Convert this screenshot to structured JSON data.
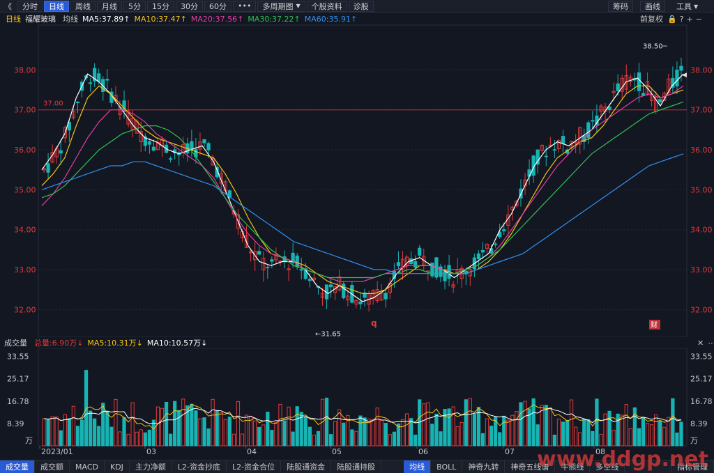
{
  "toolbar": {
    "back": "《",
    "tabs": [
      "分时",
      "日线",
      "周线",
      "月线",
      "5分",
      "15分",
      "30分",
      "60分"
    ],
    "active_tab": 1,
    "more": "•••",
    "multi_period": "多周期图",
    "stock_info": "个股资料",
    "diagnose": "诊股",
    "chips": "筹码",
    "draw": "画线",
    "tools": "工具"
  },
  "ma_bar": {
    "period": "日线",
    "name": "福耀玻璃",
    "avg": "均线",
    "ma5": "MA5:37.89↑",
    "ma10": "MA10:37.47↑",
    "ma20": "MA20:37.56↑",
    "ma30": "MA30:37.22↑",
    "ma60": "MA60:35.91↑",
    "adjust": "前复权"
  },
  "colors": {
    "ma5": "#ffffff",
    "ma10": "#f5c518",
    "ma20": "#e040a0",
    "ma30": "#30c050",
    "ma60": "#3090f0",
    "up": "#e23a3a",
    "down": "#18b4b4",
    "price_axis": "#e23a3a"
  },
  "price_axis": [
    "38.00",
    "37.00",
    "36.00",
    "35.00",
    "34.00",
    "33.00",
    "32.00"
  ],
  "annotations": {
    "ref_line": "37.00",
    "high": "38.50",
    "low": "←31.65",
    "q_marker": "q",
    "cai_marker": "财"
  },
  "volume_bar": {
    "label": "成交量",
    "total": "总量:6.90万↓",
    "ma5": "MA5:10.31万↓",
    "ma10": "MA10:10.57万↓"
  },
  "volume_axis": [
    "33.55",
    "25.17",
    "16.78",
    "8.39",
    "万"
  ],
  "date_axis": [
    "2023/01",
    "03",
    "04",
    "05",
    "06",
    "07",
    "08"
  ],
  "bottom_tabs_left": [
    "成交量",
    "成交额",
    "MACD",
    "KDJ",
    "主力净额",
    "L2-资金抄底",
    "L2-资金合位",
    "陆股通资金",
    "陆股通持股"
  ],
  "bottom_tabs_right": [
    "均线",
    "BOLL",
    "神奇九转",
    "神奇五线谱",
    "牛熊线",
    "多空线"
  ],
  "indicator_btn": "指标管理",
  "watermark": "www.ddgp.net",
  "chart_data": {
    "type": "candlestick",
    "series_ma": [
      {
        "name": "MA5",
        "values": [
          35.5,
          35.9,
          36.4,
          37.3,
          37.9,
          37.7,
          37.4,
          37.0,
          36.6,
          36.3,
          36.2,
          36.0,
          35.9,
          36.0,
          36.1,
          35.7,
          35.0,
          34.3,
          33.6,
          33.2,
          33.1,
          33.2,
          33.2,
          33.0,
          32.6,
          32.4,
          32.6,
          32.4,
          32.2,
          32.3,
          32.5,
          32.9,
          33.2,
          33.3,
          33.1,
          33.0,
          32.8,
          33.0,
          33.2,
          33.4,
          34.0,
          34.4,
          35.0,
          35.6,
          36.0,
          36.2,
          36.1,
          36.3,
          36.5,
          36.9,
          37.3,
          37.7,
          37.8,
          37.5,
          37.1,
          37.6,
          37.9
        ]
      },
      {
        "name": "MA10",
        "values": [
          35.1,
          35.4,
          35.8,
          36.6,
          37.3,
          37.6,
          37.4,
          37.1,
          36.8,
          36.5,
          36.3,
          36.2,
          36.1,
          36.0,
          35.9,
          35.8,
          35.4,
          34.9,
          34.3,
          33.8,
          33.4,
          33.3,
          33.2,
          33.1,
          32.9,
          32.7,
          32.6,
          32.5,
          32.4,
          32.4,
          32.5,
          32.7,
          32.9,
          33.1,
          33.1,
          33.0,
          32.9,
          32.9,
          33.0,
          33.2,
          33.5,
          33.9,
          34.4,
          34.9,
          35.4,
          35.8,
          36.0,
          36.2,
          36.3,
          36.6,
          37.0,
          37.4,
          37.6,
          37.6,
          37.3,
          37.4,
          37.5
        ]
      },
      {
        "name": "MA20",
        "values": [
          34.6,
          34.9,
          35.3,
          35.8,
          36.3,
          36.7,
          37.0,
          37.0,
          36.9,
          36.7,
          36.4,
          36.2,
          36.0,
          35.8,
          35.6,
          35.3,
          34.8,
          34.3,
          33.9,
          33.6,
          33.4,
          33.3,
          33.2,
          33.0,
          32.9,
          32.8,
          32.7,
          32.7,
          32.7,
          32.8,
          32.9,
          33.0,
          33.1,
          33.1,
          33.1,
          33.0,
          33.0,
          33.0,
          33.1,
          33.3,
          33.6,
          34.0,
          34.4,
          34.8,
          35.2,
          35.6,
          35.9,
          36.2,
          36.5,
          36.7,
          36.9,
          37.1,
          37.3,
          37.4,
          37.3,
          37.4,
          37.6
        ]
      },
      {
        "name": "MA30",
        "values": [
          34.8,
          34.9,
          35.1,
          35.4,
          35.7,
          36.0,
          36.2,
          36.4,
          36.5,
          36.6,
          36.6,
          36.5,
          36.3,
          36.0,
          35.6,
          35.2,
          34.8,
          34.4,
          34.1,
          33.8,
          33.5,
          33.3,
          33.1,
          33.0,
          32.9,
          32.8,
          32.8,
          32.8,
          32.8,
          32.8,
          32.9,
          32.9,
          33.0,
          33.0,
          32.9,
          32.9,
          32.9,
          33.0,
          33.1,
          33.3,
          33.5,
          33.8,
          34.1,
          34.4,
          34.7,
          35.0,
          35.3,
          35.6,
          35.9,
          36.1,
          36.3,
          36.5,
          36.7,
          36.9,
          37.0,
          37.1,
          37.2
        ]
      },
      {
        "name": "MA60",
        "values": [
          35.0,
          35.1,
          35.2,
          35.3,
          35.4,
          35.5,
          35.6,
          35.6,
          35.7,
          35.7,
          35.6,
          35.5,
          35.4,
          35.3,
          35.2,
          35.1,
          34.9,
          34.7,
          34.5,
          34.3,
          34.1,
          33.9,
          33.7,
          33.6,
          33.5,
          33.4,
          33.3,
          33.2,
          33.1,
          33.0,
          33.0,
          32.9,
          32.9,
          32.9,
          32.9,
          32.9,
          32.9,
          32.9,
          33.0,
          33.1,
          33.2,
          33.3,
          33.4,
          33.6,
          33.8,
          34.0,
          34.2,
          34.4,
          34.6,
          34.8,
          35.0,
          35.2,
          35.4,
          35.6,
          35.7,
          35.8,
          35.9
        ]
      }
    ],
    "price_range": [
      31.5,
      38.6
    ],
    "high": 38.5,
    "low": 31.65,
    "ref_level": 37.0,
    "volume_ma5_label": "MA5",
    "volume_ma10_label": "MA10",
    "volume_range": [
      0,
      35
    ]
  }
}
